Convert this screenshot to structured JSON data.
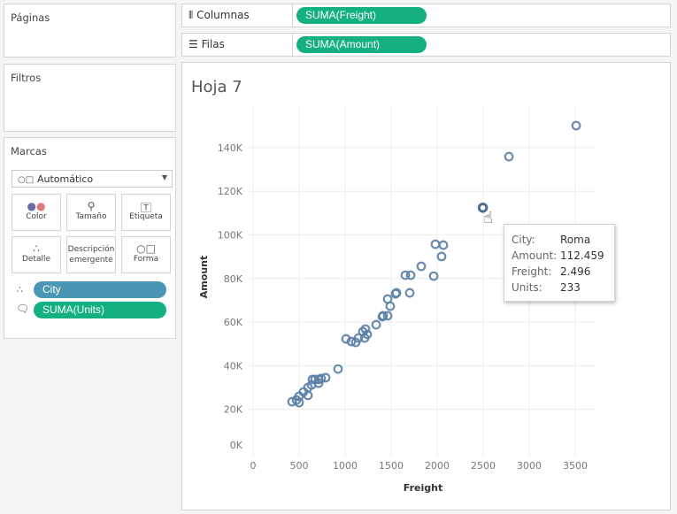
{
  "panels": {
    "pages": "Páginas",
    "filters": "Filtros",
    "marks": "Marcas"
  },
  "marks": {
    "type": "Automático",
    "buttons": [
      {
        "label": "Color",
        "icon": "color-icon"
      },
      {
        "label": "Tamaño",
        "icon": "size-icon"
      },
      {
        "label": "Etiqueta",
        "icon": "label-icon"
      },
      {
        "label": "Detalle",
        "icon": "detail-icon"
      },
      {
        "label": "Descripción emergente",
        "icon": "tooltip-icon"
      },
      {
        "label": "Forma",
        "icon": "shape-icon"
      }
    ],
    "fields": [
      {
        "label": "City",
        "icon": "detail-icon",
        "color": "#4b96b4"
      },
      {
        "label": "SUMA(Units)",
        "icon": "tooltip-icon",
        "color": "#15b081"
      }
    ]
  },
  "shelves": {
    "columns": {
      "label": "Columnas",
      "pill": "SUMA(Freight)"
    },
    "rows": {
      "label": "Filas",
      "pill": "SUMA(Amount)"
    }
  },
  "sheet": {
    "title": "Hoja 7"
  },
  "tooltip": {
    "rows": [
      {
        "k": "City:",
        "v": "Roma"
      },
      {
        "k": "Amount:",
        "v": "112.459"
      },
      {
        "k": "Freight:",
        "v": "2.496"
      },
      {
        "k": "Units:",
        "v": "233"
      }
    ]
  },
  "chart_data": {
    "type": "scatter",
    "xlabel": "Freight",
    "ylabel": "Amount",
    "xlim": [
      0,
      3600
    ],
    "ylim": [
      0,
      150000
    ],
    "xticks": [
      "0",
      "500",
      "1000",
      "1500",
      "2000",
      "2500",
      "3000",
      "3500"
    ],
    "yticks": [
      "0K",
      "20K",
      "40K",
      "60K",
      "80K",
      "100K",
      "120K",
      "140K"
    ],
    "grid": true,
    "mark_color": "#5b7fa6",
    "points": [
      [
        3510,
        150100
      ],
      [
        2780,
        135900
      ],
      [
        2496,
        112459
      ],
      [
        1981,
        95700
      ],
      [
        2067,
        95300
      ],
      [
        2048,
        90100
      ],
      [
        1827,
        85600
      ],
      [
        1962,
        81100
      ],
      [
        1654,
        81500
      ],
      [
        1712,
        81500
      ],
      [
        1702,
        73400
      ],
      [
        1548,
        73000
      ],
      [
        1558,
        73400
      ],
      [
        1462,
        70600
      ],
      [
        1490,
        67300
      ],
      [
        1413,
        62900
      ],
      [
        1462,
        62900
      ],
      [
        1404,
        62500
      ],
      [
        1337,
        58800
      ],
      [
        1221,
        56800
      ],
      [
        1192,
        55600
      ],
      [
        1240,
        54400
      ],
      [
        1212,
        52700
      ],
      [
        1144,
        52700
      ],
      [
        1115,
        50700
      ],
      [
        1067,
        51100
      ],
      [
        1010,
        52300
      ],
      [
        923,
        38500
      ],
      [
        788,
        34500
      ],
      [
        740,
        34100
      ],
      [
        712,
        33700
      ],
      [
        673,
        33700
      ],
      [
        644,
        33700
      ],
      [
        712,
        32000
      ],
      [
        635,
        31200
      ],
      [
        596,
        30000
      ],
      [
        548,
        28000
      ],
      [
        596,
        26400
      ],
      [
        500,
        26000
      ],
      [
        471,
        24300
      ],
      [
        423,
        23500
      ],
      [
        500,
        23100
      ]
    ],
    "highlighted_point": [
      2496,
      112459
    ]
  }
}
